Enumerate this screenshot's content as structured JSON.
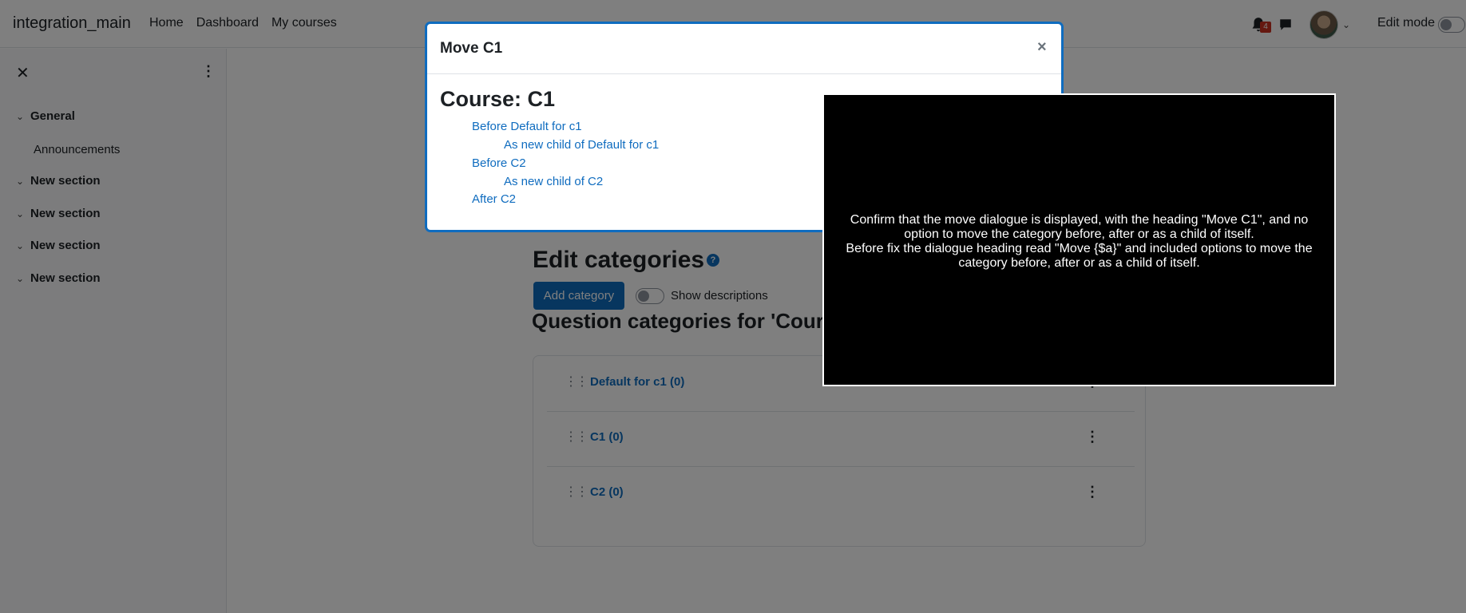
{
  "navbar": {
    "brand": "integration_main",
    "links": [
      "Home",
      "Dashboard",
      "My courses"
    ],
    "notification_count": "4",
    "edit_mode_label": "Edit mode"
  },
  "drawer": {
    "sections": [
      {
        "label": "General",
        "items": [
          "Announcements"
        ]
      },
      {
        "label": "New section",
        "items": []
      },
      {
        "label": "New section",
        "items": []
      },
      {
        "label": "New section",
        "items": []
      },
      {
        "label": "New section",
        "items": []
      }
    ]
  },
  "main": {
    "heading": "Edit categories",
    "add_button": "Add category",
    "show_descriptions": "Show descriptions",
    "categories_heading": "Question categories for 'Cour",
    "categories": [
      "Default for c1 (0)",
      "C1 (0)",
      "C2 (0)"
    ]
  },
  "modal": {
    "title": "Move C1",
    "close_symbol": "×",
    "course_title": "Course: C1",
    "options": [
      "Before Default for c1",
      "As new child of Default for c1",
      "Before C2",
      "As new child of C2",
      "After C2"
    ]
  },
  "instructions": {
    "line1": "Confirm that the move dialogue is displayed, with the heading \"Move C1\", and no option to move the category before, after or as a child of itself.",
    "line2": "Before fix the dialogue heading read \"Move {$a}\" and included options to move the category before, after or as a child of itself."
  }
}
